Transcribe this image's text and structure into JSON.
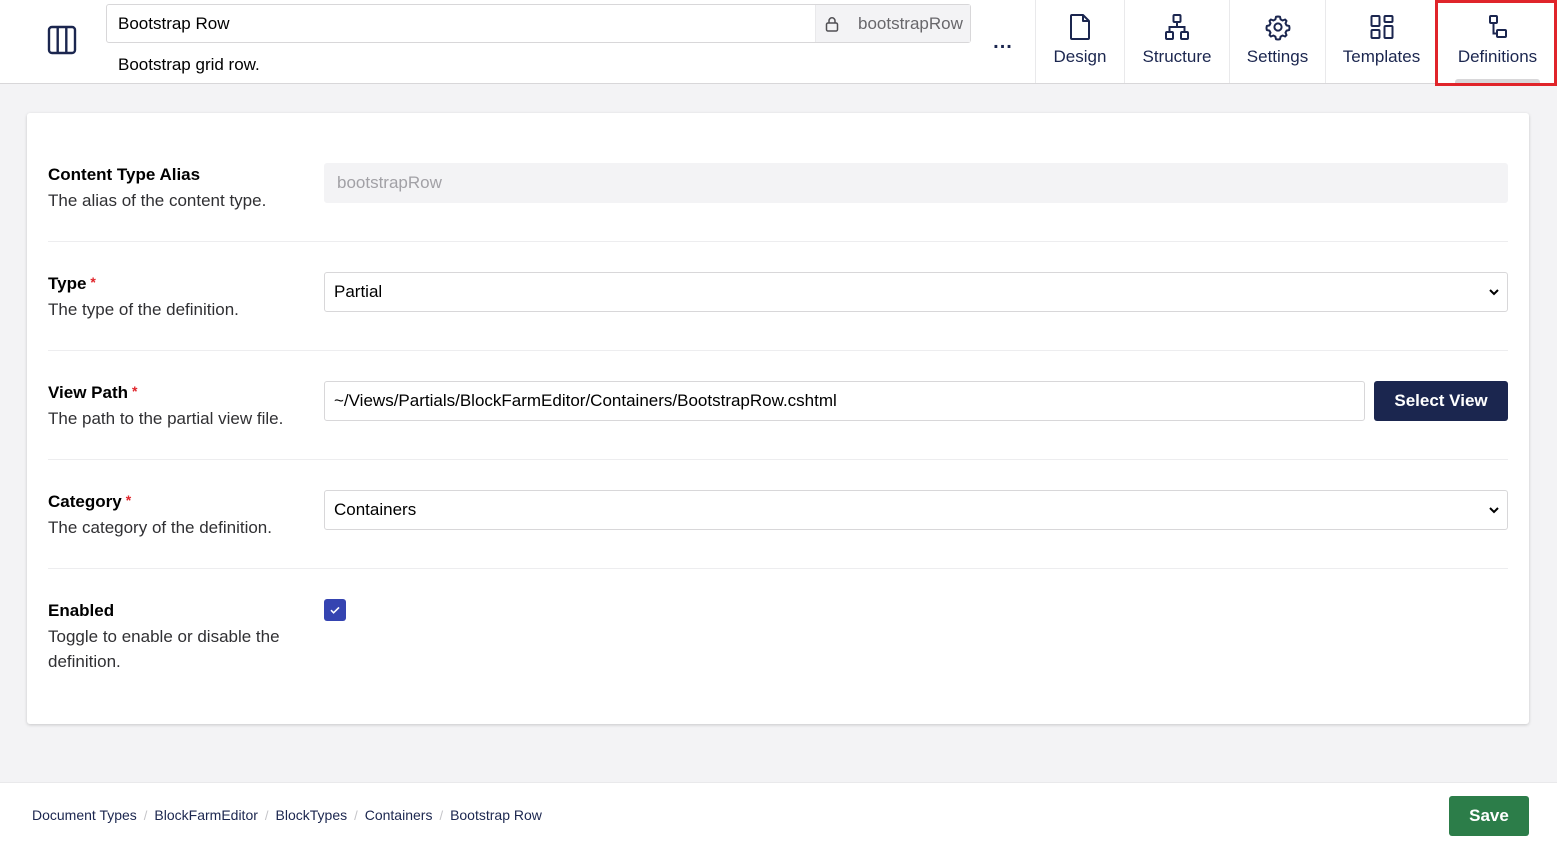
{
  "header": {
    "name": "Bootstrap Row",
    "alias": "bootstrapRow",
    "description": "Bootstrap grid row.",
    "more_label": "...",
    "tabs": [
      {
        "label": "Design",
        "icon": "document-icon"
      },
      {
        "label": "Structure",
        "icon": "sitemap-icon"
      },
      {
        "label": "Settings",
        "icon": "gear-icon"
      },
      {
        "label": "Templates",
        "icon": "grid-icon"
      },
      {
        "label": "Definitions",
        "icon": "definitions-icon",
        "active": true
      }
    ],
    "highlight_color": "#e0242a"
  },
  "form": {
    "alias": {
      "label": "Content Type Alias",
      "description": "The alias of the content type.",
      "value": "bootstrapRow"
    },
    "type": {
      "label": "Type",
      "required_mark": "*",
      "description": "The type of the definition.",
      "value": "Partial"
    },
    "view_path": {
      "label": "View Path",
      "required_mark": "*",
      "description": "The path to the partial view file.",
      "value": "~/Views/Partials/BlockFarmEditor/Containers/BootstrapRow.cshtml",
      "button_label": "Select View"
    },
    "category": {
      "label": "Category",
      "required_mark": "*",
      "description": "The category of the definition.",
      "value": "Containers"
    },
    "enabled": {
      "label": "Enabled",
      "description": "Toggle to enable or disable the definition.",
      "checked": true
    }
  },
  "footer": {
    "breadcrumb": [
      "Document Types",
      "BlockFarmEditor",
      "BlockTypes",
      "Containers",
      "Bootstrap Row"
    ],
    "separator": "/",
    "save_label": "Save"
  },
  "colors": {
    "primary": "#1b264f",
    "save": "#2c7d49",
    "checkbox": "#3544b1",
    "required": "#e0242a"
  }
}
